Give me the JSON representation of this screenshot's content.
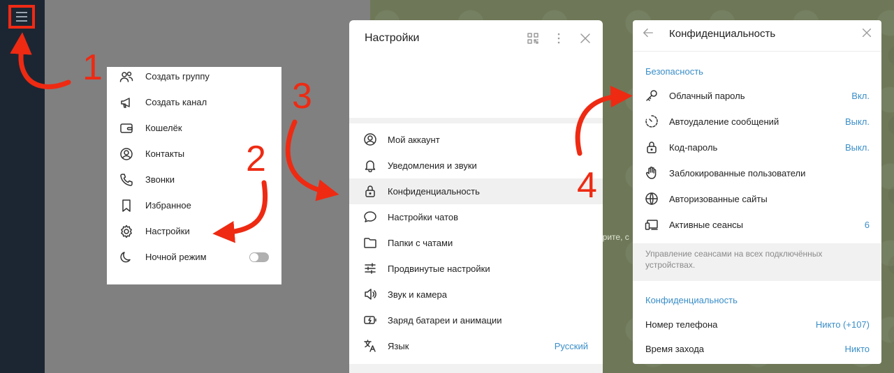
{
  "app": {
    "accent_color": "#3a8ec8",
    "annotation_color": "#ee2a13"
  },
  "chat": {
    "hint_text": "ерите, с"
  },
  "menu": {
    "button_icon": "hamburger-icon",
    "items": [
      {
        "label": "Создать группу",
        "icon": "group-icon"
      },
      {
        "label": "Создать канал",
        "icon": "megaphone-icon"
      },
      {
        "label": "Кошелёк",
        "icon": "wallet-icon"
      },
      {
        "label": "Контакты",
        "icon": "contact-icon"
      },
      {
        "label": "Звонки",
        "icon": "phone-icon"
      },
      {
        "label": "Избранное",
        "icon": "bookmark-icon"
      },
      {
        "label": "Настройки",
        "icon": "gear-icon"
      },
      {
        "label": "Ночной режим",
        "icon": "moon-icon",
        "toggle_on": false
      }
    ]
  },
  "settings": {
    "title": "Настройки",
    "items": [
      {
        "label": "Мой аккаунт",
        "icon": "user-icon"
      },
      {
        "label": "Уведомления и звуки",
        "icon": "bell-icon"
      },
      {
        "label": "Конфиденциальность",
        "icon": "lock-icon",
        "active": true
      },
      {
        "label": "Настройки чатов",
        "icon": "chat-bubble-icon"
      },
      {
        "label": "Папки с чатами",
        "icon": "folder-icon"
      },
      {
        "label": "Продвинутые настройки",
        "icon": "sliders-icon"
      },
      {
        "label": "Звук и камера",
        "icon": "speaker-icon"
      },
      {
        "label": "Заряд батареи и анимации",
        "icon": "battery-icon"
      },
      {
        "label": "Язык",
        "icon": "translate-icon",
        "value": "Русский"
      }
    ]
  },
  "privacy": {
    "title": "Конфиденциальность",
    "security_header": "Безопасность",
    "security_items": [
      {
        "label": "Облачный пароль",
        "value": "Вкл.",
        "icon": "key-icon"
      },
      {
        "label": "Автоудаление сообщений",
        "value": "Выкл.",
        "icon": "timer-icon"
      },
      {
        "label": "Код-пароль",
        "value": "Выкл.",
        "icon": "lock-icon"
      },
      {
        "label": "Заблокированные пользователи",
        "value": "",
        "icon": "hand-icon"
      },
      {
        "label": "Авторизованные сайты",
        "value": "",
        "icon": "globe-icon"
      },
      {
        "label": "Активные сеансы",
        "value": "6",
        "icon": "devices-icon"
      }
    ],
    "sessions_note": "Управление сеансами на всех подключённых устройствах.",
    "privacy_header": "Конфиденциальность",
    "privacy_items": [
      {
        "label": "Номер телефона",
        "value": "Никто (+107)"
      },
      {
        "label": "Время захода",
        "value": "Никто"
      }
    ]
  },
  "annotations": {
    "steps": [
      "1",
      "2",
      "3",
      "4"
    ]
  }
}
